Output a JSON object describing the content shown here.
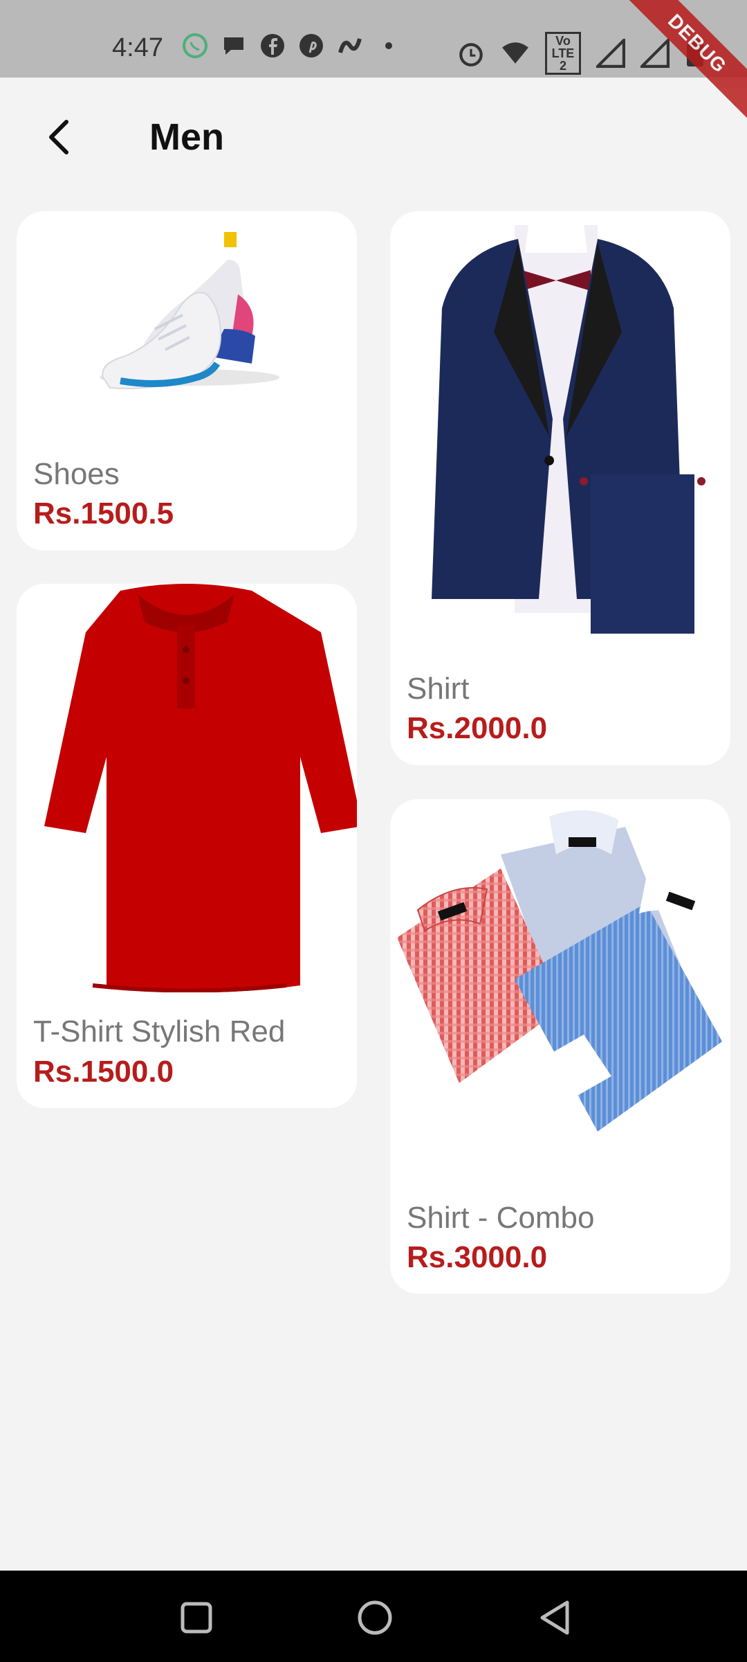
{
  "status_bar": {
    "time": "4:47",
    "icons": [
      "whatsapp-icon",
      "chat-icon",
      "facebook-icon",
      "pinterest-icon",
      "app-icon",
      "dot-icon"
    ],
    "right_icons": [
      "alarm-icon",
      "wifi-icon",
      "volte-icon",
      "signal-icon",
      "signal-icon",
      "battery-icon"
    ],
    "volte_text": "Vo LTE 2",
    "debug_label": "DEBUG"
  },
  "app_bar": {
    "title": "Men",
    "back_icon": "arrow-back-icon"
  },
  "products": [
    {
      "name": "Shoes",
      "price": "Rs.1500.5"
    },
    {
      "name": "T-Shirt Stylish Red",
      "price": "Rs.1500.0"
    },
    {
      "name": "Shirt",
      "price": "Rs.2000.0"
    },
    {
      "name": "Shirt - Combo",
      "price": "Rs.3000.0"
    }
  ],
  "nav_bar": {
    "icons": [
      "recents-square-icon",
      "home-circle-icon",
      "back-triangle-icon"
    ]
  },
  "colors": {
    "background": "#f3f3f3",
    "card": "#ffffff",
    "price": "#b71c1c",
    "name": "#777777",
    "status_bar": "#b9b9b9"
  }
}
